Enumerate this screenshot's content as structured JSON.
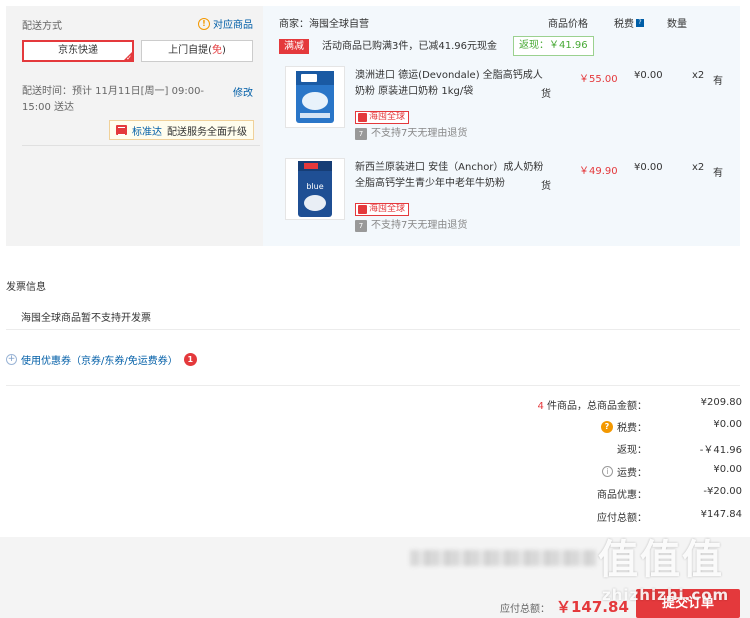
{
  "shipping": {
    "title": "配送方式",
    "match_link": "对应商品",
    "options": [
      "京东快递",
      "上门自提"
    ],
    "free_tag": "免",
    "time_text": "配送时间：预计 11月11日[周一] 09:00-15:00 送达",
    "modify": "修改",
    "std_name": "标准达",
    "std_text": "配送服务全面升级"
  },
  "store": {
    "merchant": "商家：海囤全球自营",
    "col_price": "商品价格",
    "col_tax": "税费",
    "col_qty": "数量",
    "promo_tag": "满减",
    "promo_text": "活动商品已购满3件，已减41.96元现金",
    "rebate": "返现：￥41.96"
  },
  "products": [
    {
      "name": "澳洲进口 德运(Devondale) 全脂高钙成人奶粉 原装进口奶粉 1kg/袋",
      "tail": "货",
      "price": "￥55.00",
      "tax": "¥0.00",
      "qty": "x2",
      "stock": "有",
      "badge": "海囤全球",
      "return_text": "不支持7天无理由退货"
    },
    {
      "name": "新西兰原装进口 安佳（Anchor）成人奶粉 全脂高钙学生青少年中老年牛奶粉",
      "tail": "货",
      "price": "￥49.90",
      "tax": "¥0.00",
      "qty": "x2",
      "stock": "有",
      "badge": "海囤全球",
      "return_text": "不支持7天无理由退货"
    }
  ],
  "invoice": {
    "title": "发票信息",
    "text": "海囤全球商品暂不支持开发票"
  },
  "coupon": {
    "label": "使用优惠券（京券/东券/免运费券）",
    "count": "1"
  },
  "summary": {
    "count": "4",
    "count_text": " 件商品，总商品金额：",
    "total": "¥209.80",
    "tax_label": "税费：",
    "tax": "¥0.00",
    "rebate_label": "返现：",
    "rebate": "-￥41.96",
    "shipping_label": "运费：",
    "shipping": "¥0.00",
    "discount_label": "商品优惠：",
    "discount": "-¥20.00",
    "due_label": "应付总额：",
    "due": "¥147.84"
  },
  "bottom": {
    "pay_label": "应付总额：",
    "pay_value": "￥147.84",
    "submit": "提交订单"
  },
  "watermark": {
    "chars": "值值值",
    "url": "zhizhizhi.com"
  },
  "colors": {
    "accent": "#e4393c",
    "link": "#005ea7",
    "rebate_green": "#48a935"
  }
}
